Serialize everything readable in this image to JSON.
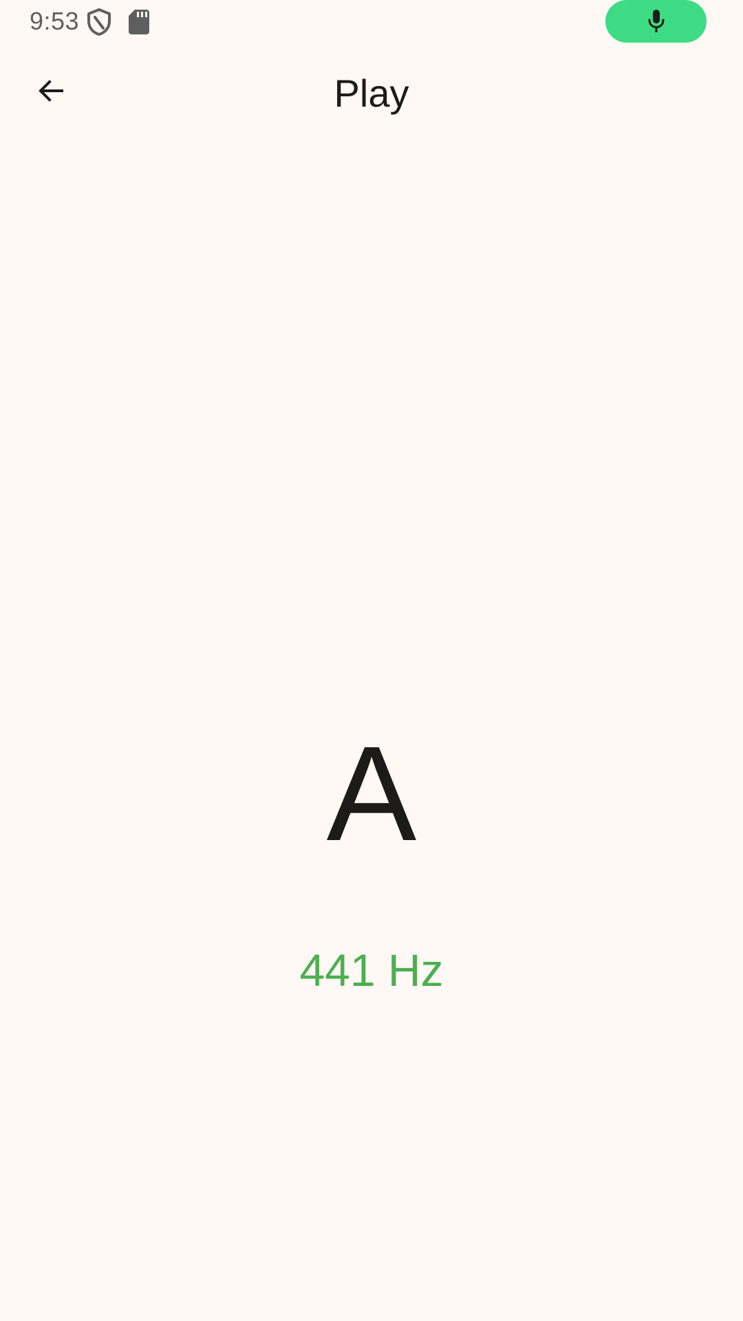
{
  "status_bar": {
    "time": "9:53",
    "icons": [
      "shield-icon",
      "sd-card-icon"
    ],
    "mic_indicator_icon": "mic-icon"
  },
  "top_bar": {
    "back_icon": "arrow-back-icon",
    "title": "Play"
  },
  "main": {
    "note": "A",
    "frequency": "441 Hz"
  },
  "colors": {
    "background": "#FFF8F5",
    "mic_pill": "#3DDC84",
    "frequency_text": "#4CAF50",
    "primary_text": "#1C1B1A"
  }
}
